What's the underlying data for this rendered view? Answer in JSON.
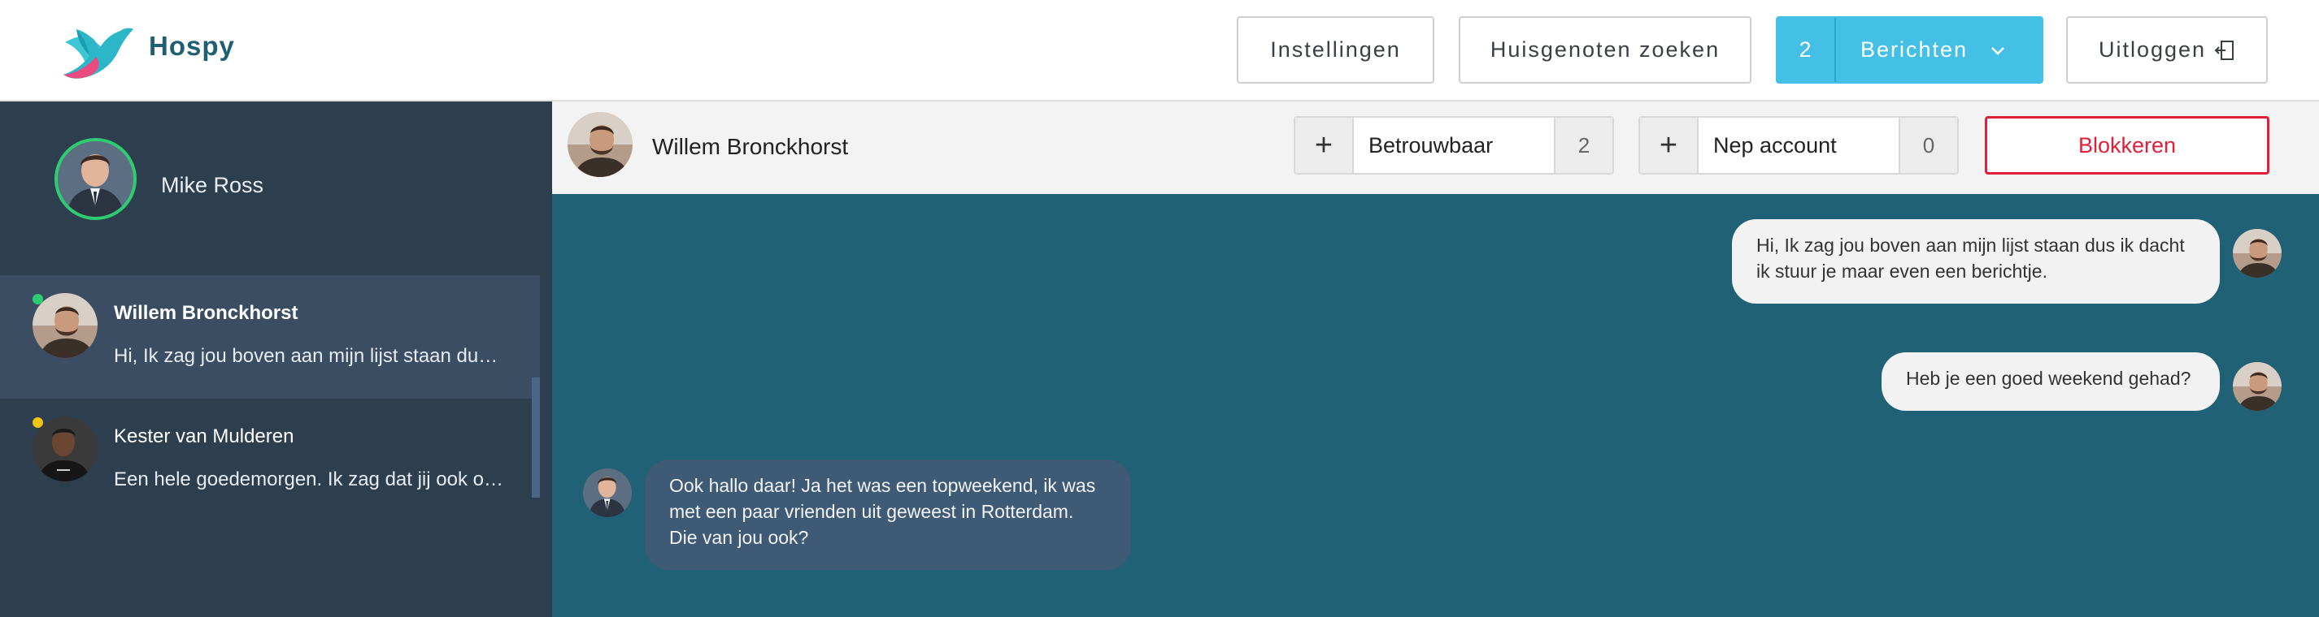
{
  "app": {
    "brand": "Hospy"
  },
  "nav": {
    "settings": "Instellingen",
    "search": "Huisgenoten zoeken",
    "messages_count": "2",
    "messages": "Berichten",
    "logout": "Uitloggen"
  },
  "sidebar": {
    "user_name": "Mike Ross",
    "conversations": [
      {
        "name": "Willem Bronckhorst",
        "preview": "Hi, Ik zag jou boven aan mijn lijst staan dus ik dacht ik stuur je maar even een berichtje.",
        "status": "online",
        "status_color": "#2ecc71"
      },
      {
        "name": "Kester van Mulderen",
        "preview": "Een hele goedemorgen. Ik zag dat jij ook op zoek bent naar een kamer.",
        "status": "away",
        "status_color": "#f1c40f"
      }
    ]
  },
  "chat": {
    "contact_name": "Willem Bronckhorst",
    "ratings": [
      {
        "label": "Betrouwbaar",
        "count": "2"
      },
      {
        "label": "Nep account",
        "count": "0"
      }
    ],
    "block_label": "Blokkeren",
    "messages": [
      {
        "direction": "outgoing",
        "text": "Hi, Ik zag jou boven aan mijn lijst staan dus ik dacht ik stuur je maar even een berichtje."
      },
      {
        "direction": "outgoing",
        "text": "Heb je een goed weekend gehad?"
      },
      {
        "direction": "incoming",
        "text": "Ook hallo daar! Ja het was een topweekend, ik was met een paar vrienden uit geweest in Rotterdam. Die van jou ook?"
      }
    ]
  },
  "colors": {
    "brand": "#1f5f73",
    "accent": "#44bfe6",
    "sidebar": "#2d3e4f",
    "chat_bg": "#206175",
    "danger": "#e0203a"
  }
}
